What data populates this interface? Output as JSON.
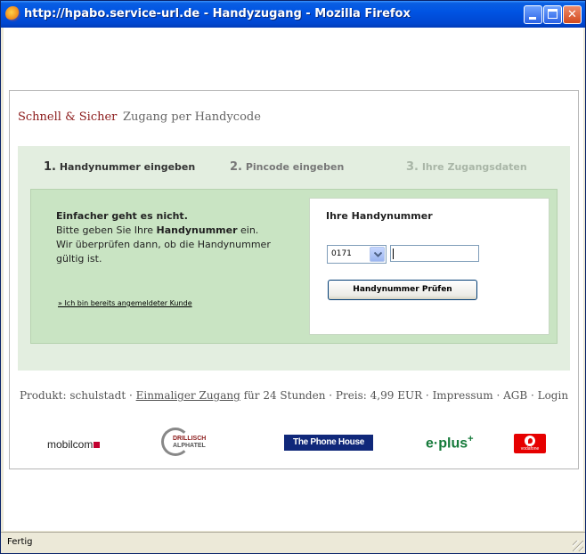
{
  "window": {
    "title": "http://hpabo.service-url.de - Handyzugang - Mozilla Firefox"
  },
  "header": {
    "brand": "Schnell & Sicher",
    "subtitle": "Zugang per Handycode"
  },
  "steps": [
    {
      "num": "1.",
      "label": "Handynummer eingeben"
    },
    {
      "num": "2.",
      "label": "Pincode eingeben"
    },
    {
      "num": "3.",
      "label": "Ihre Zugangsdaten"
    }
  ],
  "intro": {
    "heading": "Einfacher geht es nicht.",
    "line1_pre": "Bitte geben Sie Ihre ",
    "line1_bold": "Handynummer",
    "line1_post": " ein.",
    "line2": "Wir überprüfen dann, ob die Handynummer gültig ist.",
    "registered_link": "» Ich bin bereits angemeldeter Kunde"
  },
  "form": {
    "title": "Ihre Handynummer",
    "prefix_value": "0171",
    "number_value": "",
    "submit_label": "Handynummer Prüfen"
  },
  "footer": {
    "product": "Produkt: schulstadt",
    "sep": " · ",
    "access_link": "Einmaliger Zugang",
    "access_suffix": " für 24 Stunden",
    "price": "Preis: 4,99 EUR",
    "impressum": "Impressum",
    "agb": "AGB",
    "login": "Login"
  },
  "logos": {
    "mobilcom": "mobilcom",
    "drillisch_1": "DRILLISCH",
    "drillisch_2": "ALPHATEL",
    "phonehouse": "The Phone House",
    "eplus": "e·plus",
    "eplus_sup": "+",
    "vodafone": "vodafone"
  },
  "status": {
    "text": "Fertig"
  },
  "colors": {
    "titlebar": "#0054e3",
    "brand_red": "#8b1a1a",
    "step_bg": "#e3eee0",
    "green_box": "#c9e4c3"
  }
}
